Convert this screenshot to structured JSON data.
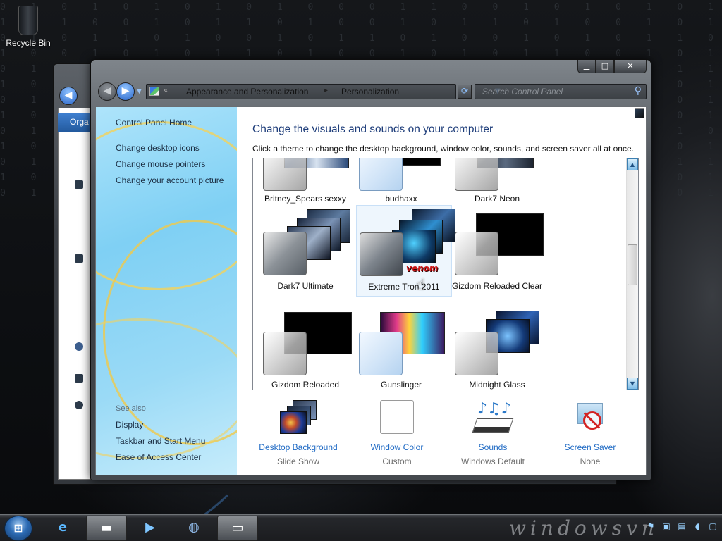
{
  "desktop": {
    "recycle_bin_label": "Recycle Bin"
  },
  "back_window": {
    "organize_label": "Orga"
  },
  "window": {
    "controls": {
      "minimize": "▁",
      "maximize": "□",
      "close": "✕"
    },
    "breadcrumbs": [
      "Appearance and Personalization",
      "Personalization"
    ],
    "search_placeholder": "Search Control Panel"
  },
  "left_nav": {
    "links": [
      "Control Panel Home",
      "Change desktop icons",
      "Change mouse pointers",
      "Change your account picture"
    ],
    "see_also_header": "See also",
    "see_also": [
      "Display",
      "Taskbar and Start Menu",
      "Ease of Access Center"
    ]
  },
  "main": {
    "title": "Change the visuals and sounds on your computer",
    "subtitle": "Click a theme to change the desktop background, window color, sounds, and screen saver all at once."
  },
  "themes": [
    {
      "name": "Britney_Spears sexxy"
    },
    {
      "name": "budhaxx"
    },
    {
      "name": "Dark7 Neon"
    },
    {
      "name": "Dark7 Ultimate"
    },
    {
      "name": "Extreme Tron 2011",
      "selected": true,
      "badge": "venom"
    },
    {
      "name": "Gizdom Reloaded Clear"
    },
    {
      "name": "Gizdom Reloaded"
    },
    {
      "name": "Gunslinger"
    },
    {
      "name": "Midnight Glass"
    }
  ],
  "settings": [
    {
      "name": "Desktop Background",
      "value": "Slide Show",
      "icon": "desktop-background-icon"
    },
    {
      "name": "Window Color",
      "value": "Custom",
      "icon": "window-color-icon"
    },
    {
      "name": "Sounds",
      "value": "Windows Default",
      "icon": "sounds-icon"
    },
    {
      "name": "Screen Saver",
      "value": "None",
      "icon": "screen-saver-icon"
    }
  ],
  "taskbar": {
    "watermark": "windowsvn",
    "colors": {
      "accent": "#1f6ac4",
      "title": "#1e3d7a"
    }
  }
}
